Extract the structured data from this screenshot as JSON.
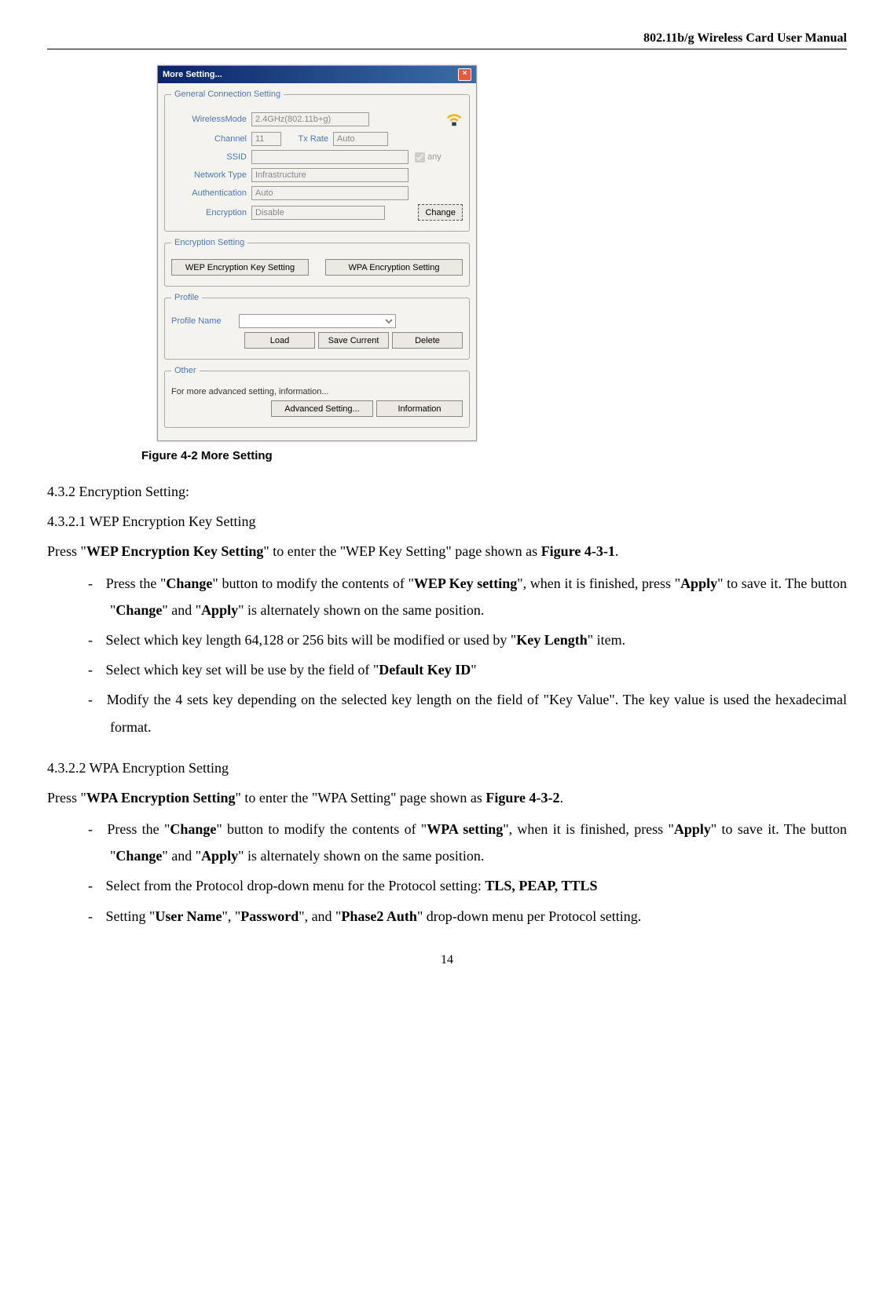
{
  "header": {
    "title": "802.11b/g Wireless Card User Manual"
  },
  "dialog": {
    "title": "More Setting...",
    "close_glyph": "×",
    "groups": {
      "general": {
        "legend": "General Connection Setting",
        "wirelessmode_label": "WirelessMode",
        "wirelessmode_value": "2.4GHz(802.11b+g)",
        "channel_label": "Channel",
        "channel_value": "11",
        "txrate_label": "Tx Rate",
        "txrate_value": "Auto",
        "ssid_label": "SSID",
        "ssid_value": "",
        "any_label": "any",
        "nettype_label": "Network Type",
        "nettype_value": "Infrastructure",
        "auth_label": "Authentication",
        "auth_value": "Auto",
        "encryption_label": "Encryption",
        "encryption_value": "Disable",
        "change_btn": "Change"
      },
      "encryption": {
        "legend": "Encryption Setting",
        "wep_btn": "WEP Encryption Key Setting",
        "wpa_btn": "WPA Encryption Setting"
      },
      "profile": {
        "legend": "Profile",
        "name_label": "Profile Name",
        "load_btn": "Load",
        "save_btn": "Save Current",
        "delete_btn": "Delete"
      },
      "other": {
        "legend": "Other",
        "desc": "For more advanced setting, information...",
        "adv_btn": "Advanced Setting...",
        "info_btn": "Information"
      }
    }
  },
  "figure_caption": "Figure 4-2 More Setting",
  "sections": {
    "s432": "4.3.2 Encryption Setting:",
    "s4321_title": "4.3.2.1 WEP Encryption Key Setting",
    "s4321_p1a": "Press \"",
    "s4321_p1b": "WEP Encryption Key Setting",
    "s4321_p1c": "\" to enter the \"WEP Key Setting\" page shown as ",
    "s4321_p1d": "Figure 4-3-1",
    "s4321_p1e": ".",
    "s4321_li1": "Press the \"Change\" button to modify the contents of \"WEP Key setting\", when it is finished, press \"Apply\" to save it. The button \"Change\" and \"Apply\" is alternately shown on the same position.",
    "s4321_li2": "Select which key length 64,128 or 256 bits will be modified or used by \"Key Length\" item.",
    "s4321_li3": "Select which key set will be use by the field of \"Default Key ID\"",
    "s4321_li4": "Modify the 4 sets key depending on the selected key length on the field of \"Key Value\". The key value is used the hexadecimal format.",
    "s4322_title": "4.3.2.2 WPA Encryption Setting",
    "s4322_p1a": "Press \"",
    "s4322_p1b": "WPA Encryption Setting",
    "s4322_p1c": "\" to enter the \"WPA Setting\" page shown as ",
    "s4322_p1d": "Figure 4-3-2",
    "s4322_p1e": ".",
    "s4322_li1": "Press the \"Change\" button to modify the contents of \"WPA setting\", when it is finished, press \"Apply\" to save it. The button \"Change\" and \"Apply\" is alternately shown on the same position.",
    "s4322_li2": "Select from the Protocol drop-down menu for the Protocol setting: TLS, PEAP, TTLS",
    "s4322_li3": "Setting \"User Name\", \"Password\", and \"Phase2 Auth\" drop-down menu per Protocol setting."
  },
  "page_number": "14"
}
